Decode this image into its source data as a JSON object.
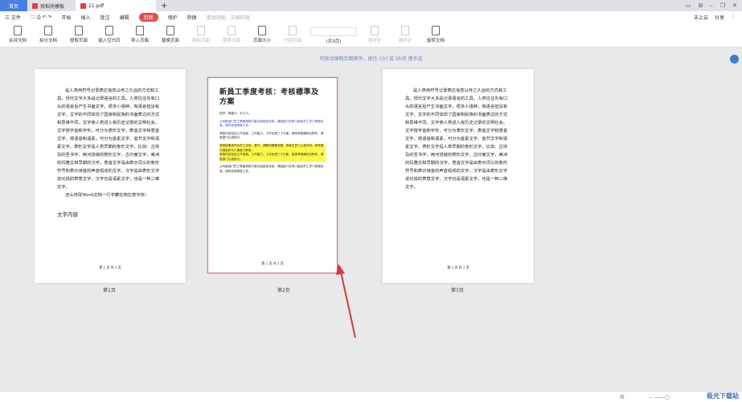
{
  "tabs": [
    {
      "label": "首页"
    },
    {
      "label": "找稻壳模板"
    },
    {
      "label": "11.pdf"
    }
  ],
  "menu": {
    "file": "三 文件",
    "items": [
      "开始",
      "插入",
      "批注",
      "编辑",
      "页面",
      "保护",
      "转换"
    ],
    "active": "页面",
    "search_placeholder": "查找功能、文档内容",
    "cloud": "未上云",
    "share": "分享"
  },
  "toolbar": {
    "buttons": [
      {
        "label": "合并文档",
        "enabled": true
      },
      {
        "label": "拆分文档",
        "enabled": true
      },
      {
        "label": "提取页面",
        "enabled": true
      },
      {
        "label": "插入空白页",
        "enabled": true
      },
      {
        "label": "导入页面",
        "enabled": true
      },
      {
        "label": "替换页面",
        "enabled": true
      },
      {
        "label": "删除页面",
        "enabled": false
      },
      {
        "label": "裁剪页面",
        "enabled": false
      },
      {
        "label": "页面大小",
        "enabled": true
      },
      {
        "label": "分割页面",
        "enabled": false
      }
    ],
    "page_count": "(共3页)",
    "rotate_left": "逆时针",
    "rotate_right": "顺时针",
    "rotate_doc": "旋转文档"
  },
  "hint": "可拖动缩略页面顺序，按住 Ctrl 或 Shift 键多选",
  "pages": [
    {
      "label": "第1页",
      "body": "是人类用符号记录表达信息以传之久远的方式和工具。现代文字大多是记录语言的工具。人类往往先有口头的语言后产生书面文字，很多小语种，有语言但没有文字。文字的不同体现了国家和民族的书面表达的方式和思维不同。文字使人类进入有历史记录的文明社会。文字按字音和字形，可分为表形文字、表音文字和意音文字。按语音和语素，可分为音素文字、音节文字和语素文字。表形文字是人类早期的象形文字，比如：古埃及的圣书字，两河流域的楔形文字，古印度文字，美洲的玛雅文和早期的汉字。意音文字是由表示词义的象形符号和表示读音的声音组成的文字。汉字是由表形文字进化成的表意文字，汉字也是语素文字，也是一种二维文字。",
      "line2": "怎么修改Word文档一行字藏在随在意字体!",
      "line3": "文字内容",
      "footer": "第 1 页 共 3 页"
    },
    {
      "label": "第2页",
      "title": "新員工季度考核：考核標準及方案",
      "body1": "您好，很高兴，平凡人。",
      "body2": "公司各部门员工季度考核方案已经制定完成，请各部门负责人组织员工学习考核标准，按时完成考核工作。",
      "body3": "考核内容包括工作态度、工作能力、工作业绩三个方面，具体考核细则见附件，请各部门认真执行。",
      "body4": "考核结果将作为员工评优、晋升、调薪的重要依据，请各位员工认真对待，如有疑问请及时与人事部门联系。",
      "footer": "第 2 页 共 3 页"
    },
    {
      "label": "第3页",
      "body": "是人类用符号记录表达信息以传之久远的方式和工具。现代文字大多是记录语言的工具。人类往往先有口头的语言后产生书面文字，很多小语种，有语言但没有文字。文字的不同体现了国家和民族的书面表达的方式和思维不同。文字使人类进入有历史记录的文明社会。文字按字音和字形，可分为表形文字、表音文字和意音文字。按语音和语素，可分为音素文字、音节文字和语素文字。表形文字是人类早期的象形文字，比如：古埃及的圣书字，两河流域的楔形文字，古印度文字，美洲的玛雅文和早期的汉字。意音文字是由表示词义的象形符号和表示读音的声音组成的文字。汉字是由表形文字进化成的表意文字，汉字也是语素文字，也是一种二维文字。",
      "footer": "第 3 页 共 3 页"
    }
  ],
  "watermark": "极光下载站",
  "accent": "#e84c4c"
}
